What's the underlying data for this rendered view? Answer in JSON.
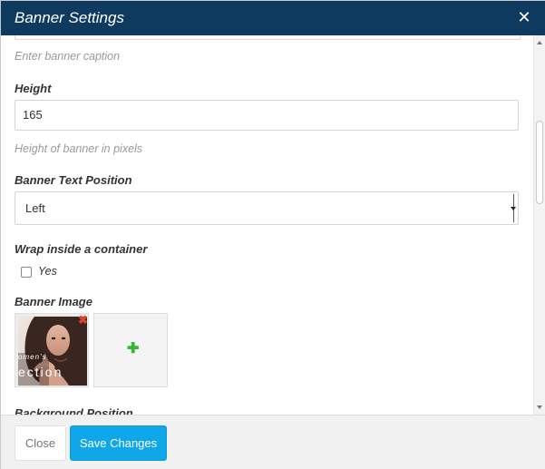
{
  "header": {
    "title": "Banner Settings",
    "close_glyph": "✕"
  },
  "fields": {
    "caption_help": "Enter banner caption",
    "height_label": "Height",
    "height_value": "165",
    "height_help": "Height of banner in pixels",
    "text_position_label": "Banner Text Position",
    "text_position_value": "Left",
    "wrap_label": "Wrap inside a container",
    "wrap_option": "Yes",
    "wrap_checked": false,
    "image_label": "Banner Image",
    "image_thumb_text_1": "omen's",
    "image_thumb_text_2": "ection",
    "next_label_partial": "Background Position"
  },
  "icons": {
    "close": "close-icon",
    "remove": "remove-image-icon",
    "add": "add-image-icon"
  },
  "footer": {
    "close_label": "Close",
    "save_label": "Save Changes"
  },
  "colors": {
    "header_bg": "#0d3a5e",
    "save_bg": "#0fa7e9",
    "remove_icon": "#d9442b",
    "add_icon": "#37b737"
  }
}
